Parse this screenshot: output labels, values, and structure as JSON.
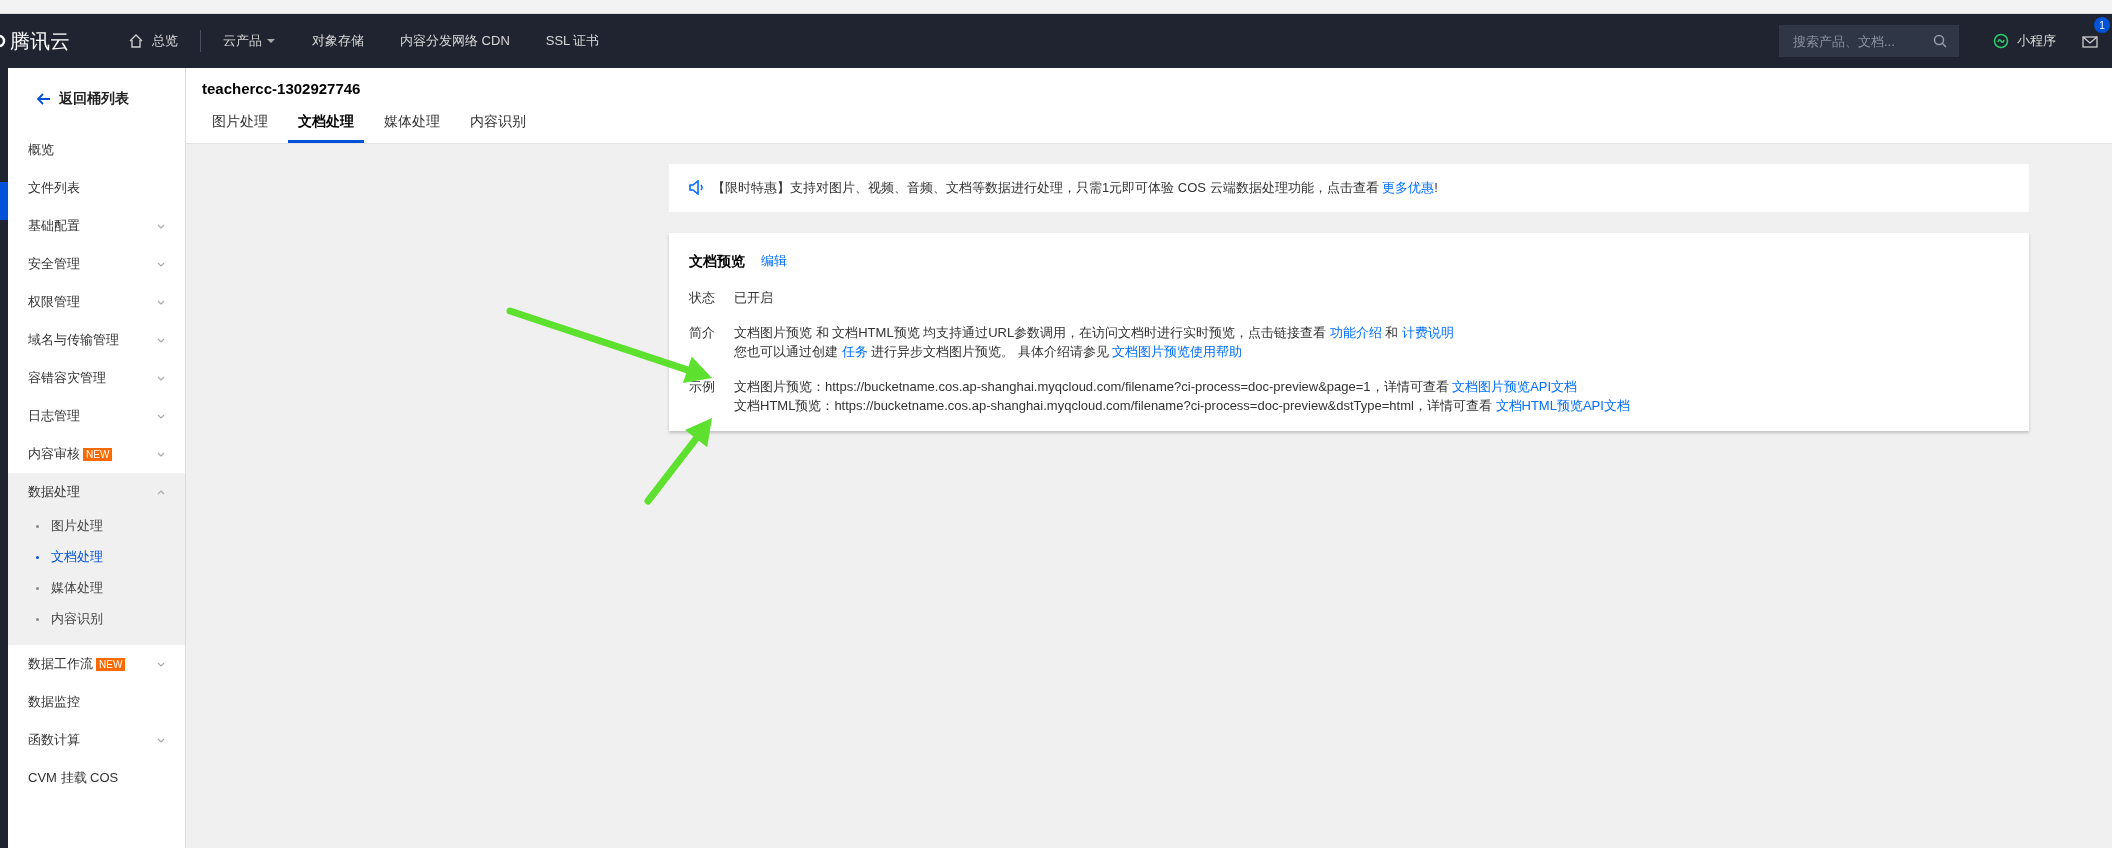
{
  "topbar": {
    "logo": "腾讯云",
    "home": "总览",
    "menus": [
      {
        "label": "云产品",
        "dropdown": true
      },
      {
        "label": "对象存储",
        "dropdown": false
      },
      {
        "label": "内容分发网络 CDN",
        "dropdown": false
      },
      {
        "label": "SSL 证书",
        "dropdown": false
      }
    ],
    "search": {
      "placeholder": "搜索产品、文档..."
    },
    "mini_program": "小程序",
    "mail_badge": "1"
  },
  "sidebar": {
    "back": "返回桶列表",
    "items": [
      {
        "label": "概览",
        "selected": false,
        "expandable": false,
        "expanded": false
      },
      {
        "label": "文件列表",
        "selected": true,
        "expandable": false,
        "expanded": false
      },
      {
        "label": "基础配置",
        "selected": false,
        "expandable": true,
        "expanded": false
      },
      {
        "label": "安全管理",
        "selected": false,
        "expandable": true,
        "expanded": false
      },
      {
        "label": "权限管理",
        "selected": false,
        "expandable": true,
        "expanded": false
      },
      {
        "label": "域名与传输管理",
        "selected": false,
        "expandable": true,
        "expanded": false
      },
      {
        "label": "容错容灾管理",
        "selected": false,
        "expandable": true,
        "expanded": false
      },
      {
        "label": "日志管理",
        "selected": false,
        "expandable": true,
        "expanded": false
      },
      {
        "label": "内容审核",
        "badge": "NEW",
        "selected": false,
        "expandable": true,
        "expanded": false
      },
      {
        "label": "数据处理",
        "selected": false,
        "expandable": true,
        "expanded": true,
        "children": [
          {
            "label": "图片处理",
            "selected": false
          },
          {
            "label": "文档处理",
            "selected": true
          },
          {
            "label": "媒体处理",
            "selected": false
          },
          {
            "label": "内容识别",
            "selected": false
          }
        ]
      },
      {
        "label": "数据工作流",
        "badge": "NEW",
        "selected": false,
        "expandable": true,
        "expanded": false
      },
      {
        "label": "数据监控",
        "selected": false,
        "expandable": false,
        "expanded": false
      },
      {
        "label": "函数计算",
        "selected": false,
        "expandable": true,
        "expanded": false
      },
      {
        "label": "CVM 挂载 COS",
        "selected": false,
        "expandable": false,
        "expanded": false
      }
    ]
  },
  "header": {
    "bucket": "teachercc-1302927746",
    "tabs": [
      {
        "label": "图片处理",
        "selected": false
      },
      {
        "label": "文档处理",
        "selected": true
      },
      {
        "label": "媒体处理",
        "selected": false
      },
      {
        "label": "内容识别",
        "selected": false
      }
    ]
  },
  "notice": {
    "segments": [
      {
        "text": "【限时特惠】支持对图片、视频、音频、文档等数据进行处理，只需1元即可体验 COS 云端数据处理功能，点击查看 ",
        "link": false
      },
      {
        "text": "更多优惠",
        "link": true
      },
      {
        "text": "!",
        "link": false
      }
    ]
  },
  "card": {
    "title": "文档预览",
    "edit": "编辑",
    "rows": [
      {
        "label": "状态",
        "lines": [
          [
            {
              "text": "已开启",
              "link": false
            }
          ]
        ]
      },
      {
        "label": "简介",
        "lines": [
          [
            {
              "text": "文档图片预览 和 文档HTML预览 均支持通过URL参数调用，在访问文档时进行实时预览，点击链接查看 ",
              "link": false
            },
            {
              "text": "功能介绍",
              "link": true
            },
            {
              "text": " 和 ",
              "link": false
            },
            {
              "text": "计费说明",
              "link": true
            }
          ],
          [
            {
              "text": "您也可以通过创建 ",
              "link": false
            },
            {
              "text": "任务",
              "link": true
            },
            {
              "text": " 进行异步文档图片预览。 具体介绍请参见 ",
              "link": false
            },
            {
              "text": "文档图片预览使用帮助",
              "link": true
            }
          ]
        ]
      },
      {
        "label": "示例",
        "lines": [
          [
            {
              "text": "文档图片预览：https://bucketname.cos.ap-shanghai.myqcloud.com/filename?ci-process=doc-preview&page=1，详情可查看 ",
              "link": false
            },
            {
              "text": "文档图片预览API文档",
              "link": true
            }
          ],
          [
            {
              "text": "文档HTML预览：https://bucketname.cos.ap-shanghai.myqcloud.com/filename?ci-process=doc-preview&dstType=html，详情可查看 ",
              "link": false
            },
            {
              "text": "文档HTML预览API文档",
              "link": true
            }
          ]
        ]
      }
    ]
  }
}
